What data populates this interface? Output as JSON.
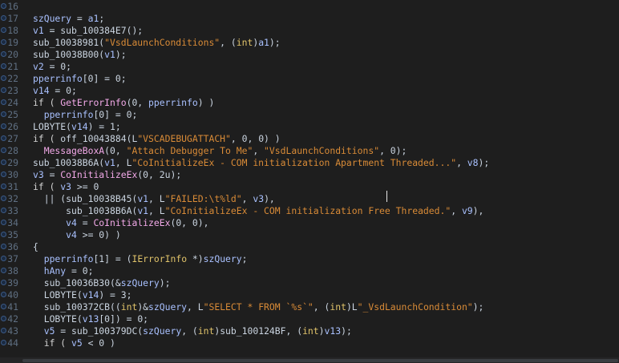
{
  "editor": {
    "line_numbers": [
      "16",
      "17",
      "18",
      "19",
      "20",
      "21",
      "22",
      "23",
      "24",
      "25",
      "26",
      "27",
      "28",
      "29",
      "30",
      "31",
      "32",
      "33",
      "34",
      "35",
      "36",
      "37",
      "38",
      "39",
      "40",
      "41",
      "42",
      "43",
      "44"
    ],
    "lines": [
      [],
      [
        [
          "t-id",
          "szQuery"
        ],
        [
          "t-sym",
          " = "
        ],
        [
          "t-id",
          "a1"
        ],
        [
          "t-sym",
          ";"
        ]
      ],
      [
        [
          "t-id",
          "v1"
        ],
        [
          "t-sym",
          " = sub_100384E7();"
        ]
      ],
      [
        [
          "t-sym",
          "sub_10038981("
        ],
        [
          "t-str",
          "\"VsdLaunchConditions\""
        ],
        [
          "t-sym",
          ", ("
        ],
        [
          "t-kw",
          "int"
        ],
        [
          "t-sym",
          ")"
        ],
        [
          "t-id",
          "a1"
        ],
        [
          "t-sym",
          ");"
        ]
      ],
      [
        [
          "t-sym",
          "sub_10038B00("
        ],
        [
          "t-id",
          "v1"
        ],
        [
          "t-sym",
          ");"
        ]
      ],
      [
        [
          "t-id",
          "v2"
        ],
        [
          "t-sym",
          " = 0;"
        ]
      ],
      [
        [
          "t-id",
          "pperrinfo"
        ],
        [
          "t-sym",
          "[0] = 0;"
        ]
      ],
      [
        [
          "t-id",
          "v14"
        ],
        [
          "t-sym",
          " = 0;"
        ]
      ],
      [
        [
          "t-kwb",
          "if ( "
        ],
        [
          "t-fn",
          "GetErrorInfo"
        ],
        [
          "t-sym",
          "(0, "
        ],
        [
          "t-id",
          "pperrinfo"
        ],
        [
          "t-sym",
          ") )"
        ]
      ],
      [
        [
          "t-sym",
          "  "
        ],
        [
          "t-id",
          "pperrinfo"
        ],
        [
          "t-sym",
          "[0] = 0;"
        ]
      ],
      [
        [
          "t-sym",
          "LOBYTE("
        ],
        [
          "t-id",
          "v14"
        ],
        [
          "t-sym",
          ") = 1;"
        ]
      ],
      [
        [
          "t-kwb",
          "if ( "
        ],
        [
          "t-sym",
          "off_10043884(L"
        ],
        [
          "t-str",
          "\"VSCADEBUGATTACH\""
        ],
        [
          "t-sym",
          ", 0, 0) )"
        ]
      ],
      [
        [
          "t-sym",
          "  "
        ],
        [
          "t-fn",
          "MessageBoxA"
        ],
        [
          "t-sym",
          "(0, "
        ],
        [
          "t-str",
          "\"Attach Debugger To Me\""
        ],
        [
          "t-sym",
          ", "
        ],
        [
          "t-str",
          "\"VsdLaunchConditions\""
        ],
        [
          "t-sym",
          ", 0);"
        ]
      ],
      [
        [
          "t-sym",
          "sub_10038B6A("
        ],
        [
          "t-id",
          "v1"
        ],
        [
          "t-sym",
          ", L"
        ],
        [
          "t-str",
          "\"CoInitializeEx - COM initialization Apartment Threaded...\""
        ],
        [
          "t-sym",
          ", "
        ],
        [
          "t-id",
          "v8"
        ],
        [
          "t-sym",
          ");"
        ]
      ],
      [
        [
          "t-id",
          "v3"
        ],
        [
          "t-sym",
          " = "
        ],
        [
          "t-fn",
          "CoInitializeEx"
        ],
        [
          "t-sym",
          "(0, 2u);"
        ]
      ],
      [
        [
          "t-kwb",
          "if ( "
        ],
        [
          "t-id",
          "v3"
        ],
        [
          "t-sym",
          " >= 0"
        ]
      ],
      [
        [
          "t-sym",
          "  || (sub_10038B45("
        ],
        [
          "t-id",
          "v1"
        ],
        [
          "t-sym",
          ", L"
        ],
        [
          "t-str",
          "\"FAILED:\\t%ld\""
        ],
        [
          "t-sym",
          ", "
        ],
        [
          "t-id",
          "v3"
        ],
        [
          "t-sym",
          "),"
        ]
      ],
      [
        [
          "t-sym",
          "      sub_10038B6A("
        ],
        [
          "t-id",
          "v1"
        ],
        [
          "t-sym",
          ", L"
        ],
        [
          "t-str",
          "\"CoInitializeEx - COM initialization Free Threaded.\""
        ],
        [
          "t-sym",
          ", "
        ],
        [
          "t-id",
          "v9"
        ],
        [
          "t-sym",
          "),"
        ]
      ],
      [
        [
          "t-sym",
          "      "
        ],
        [
          "t-id",
          "v4"
        ],
        [
          "t-sym",
          " = "
        ],
        [
          "t-fn",
          "CoInitializeEx"
        ],
        [
          "t-sym",
          "(0, 0),"
        ]
      ],
      [
        [
          "t-sym",
          "      "
        ],
        [
          "t-id",
          "v4"
        ],
        [
          "t-sym",
          " >= 0) )"
        ]
      ],
      [
        [
          "t-sym",
          "{"
        ]
      ],
      [
        [
          "t-sym",
          "  "
        ],
        [
          "t-id",
          "pperrinfo"
        ],
        [
          "t-sym",
          "[1] = ("
        ],
        [
          "t-kw",
          "IErrorInfo"
        ],
        [
          "t-sym",
          " *)"
        ],
        [
          "t-id",
          "szQuery"
        ],
        [
          "t-sym",
          ";"
        ]
      ],
      [
        [
          "t-sym",
          "  "
        ],
        [
          "t-id",
          "hAny"
        ],
        [
          "t-sym",
          " = 0;"
        ]
      ],
      [
        [
          "t-sym",
          "  sub_10036B30(&"
        ],
        [
          "t-id",
          "szQuery"
        ],
        [
          "t-sym",
          ");"
        ]
      ],
      [
        [
          "t-sym",
          "  LOBYTE("
        ],
        [
          "t-id",
          "v14"
        ],
        [
          "t-sym",
          ") = 3;"
        ]
      ],
      [
        [
          "t-sym",
          "  sub_100372CB(("
        ],
        [
          "t-kw",
          "int"
        ],
        [
          "t-sym",
          ")&"
        ],
        [
          "t-id",
          "szQuery"
        ],
        [
          "t-sym",
          ", L"
        ],
        [
          "t-str",
          "\"SELECT * FROM `%s`\""
        ],
        [
          "t-sym",
          ", ("
        ],
        [
          "t-kw",
          "int"
        ],
        [
          "t-sym",
          ")L"
        ],
        [
          "t-str",
          "\"_VsdLaunchCondition\""
        ],
        [
          "t-sym",
          ");"
        ]
      ],
      [
        [
          "t-sym",
          "  LOBYTE("
        ],
        [
          "t-id",
          "v13"
        ],
        [
          "t-sym",
          "[0]) = 0;"
        ]
      ],
      [
        [
          "t-sym",
          "  "
        ],
        [
          "t-id",
          "v5"
        ],
        [
          "t-sym",
          " = sub_100379DC("
        ],
        [
          "t-id",
          "szQuery"
        ],
        [
          "t-sym",
          ", ("
        ],
        [
          "t-kw",
          "int"
        ],
        [
          "t-sym",
          ")sub_100124BF, ("
        ],
        [
          "t-kw",
          "int"
        ],
        [
          "t-sym",
          ")"
        ],
        [
          "t-id",
          "v13"
        ],
        [
          "t-sym",
          ");"
        ]
      ],
      [
        [
          "t-sym",
          "  "
        ],
        [
          "t-kwb",
          "if ( "
        ],
        [
          "t-id",
          "v5"
        ],
        [
          "t-sym",
          " < 0 )"
        ]
      ],
      [
        [
          "t-sym",
          "  {"
        ]
      ]
    ],
    "colors": {
      "background": "#1e1e1e",
      "line_number": "#5f6f82",
      "identifier": "#a9c1ff",
      "function": "#f2a9e8",
      "string": "#d98b37",
      "keyword_type": "#e0c36a"
    }
  }
}
